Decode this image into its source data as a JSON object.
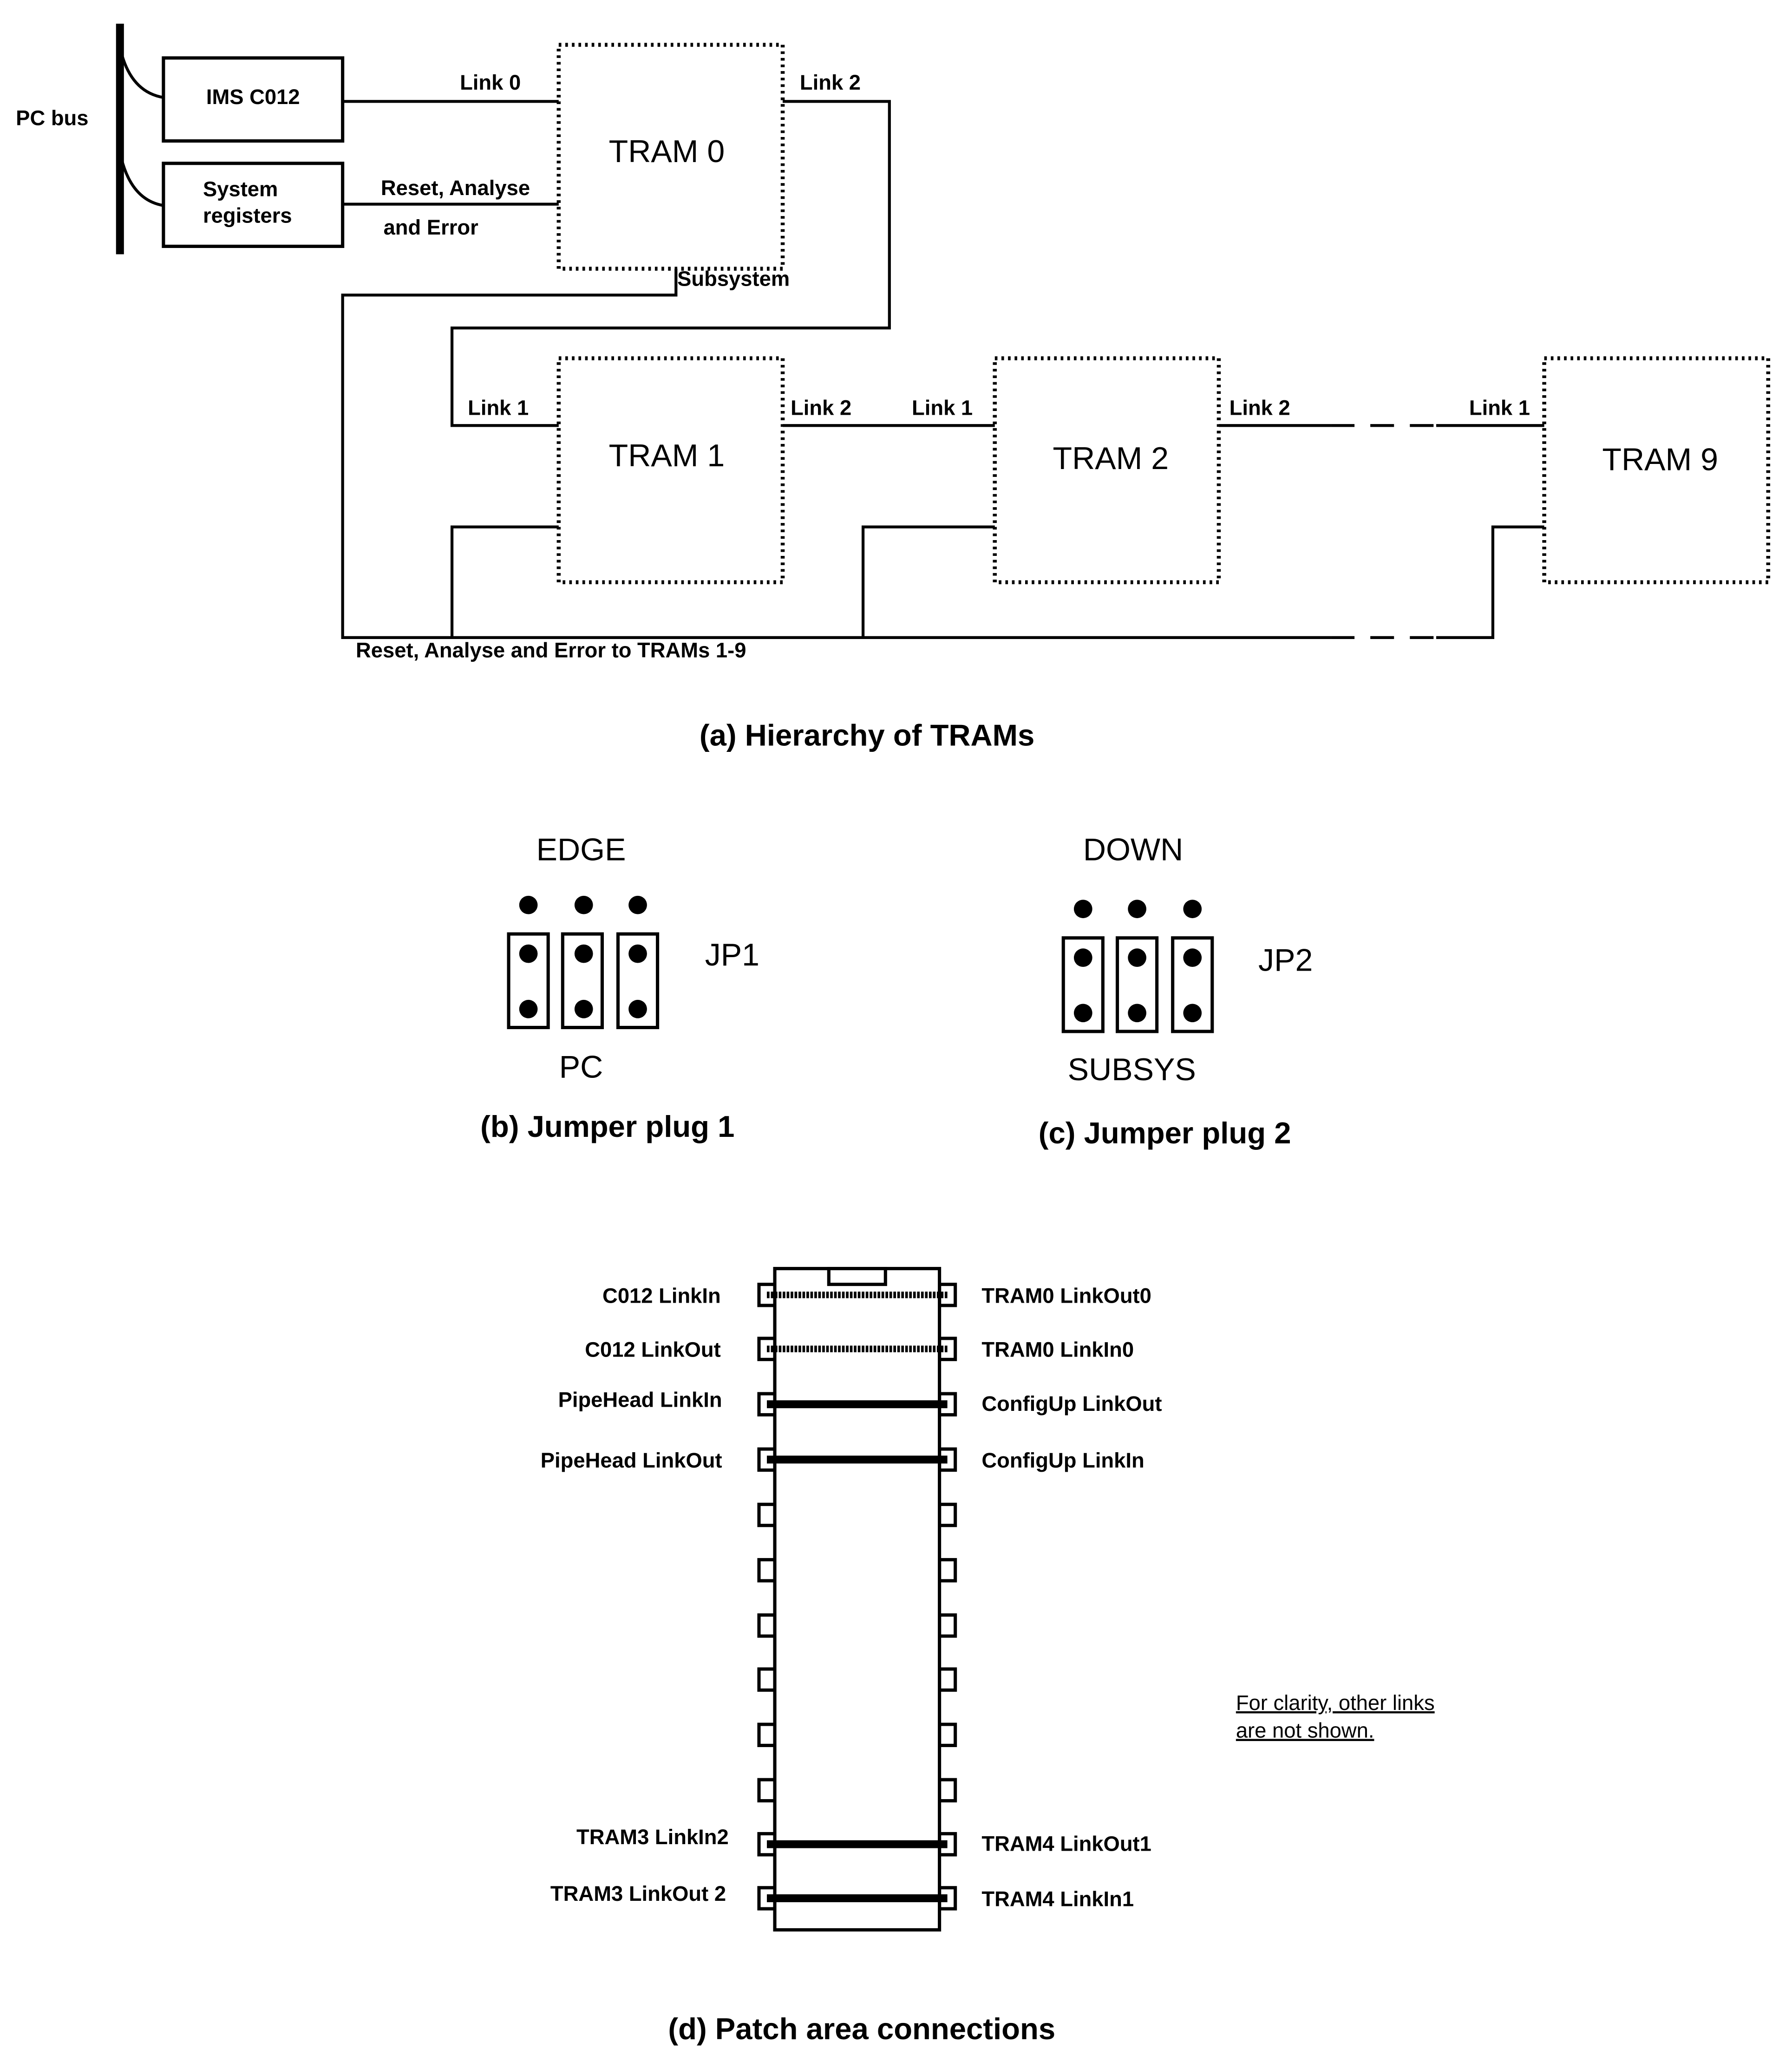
{
  "hierarchy": {
    "pc_bus": "PC bus",
    "ims_c012": "IMS C012",
    "sysreg_line1": "System",
    "sysreg_line2": "registers",
    "link0": "Link 0",
    "reset_line1": "Reset, Analyse",
    "reset_line2": "and Error",
    "tram0": "TRAM 0",
    "tram0_link2": "Link 2",
    "subsystem": "Subsystem",
    "tram1": "TRAM 1",
    "tram1_link1": "Link 1",
    "tram1_link2": "Link 2",
    "tram2": "TRAM 2",
    "tram2_link1": "Link 1",
    "tram2_link2": "Link 2",
    "tram9": "TRAM 9",
    "tram9_link1": "Link 1",
    "reset_bus": "Reset, Analyse and Error to TRAMs 1-9",
    "caption": "(a) Hierarchy of TRAMs"
  },
  "jumper1": {
    "top": "EDGE",
    "bottom": "PC",
    "name": "JP1",
    "caption": "(b) Jumper plug 1"
  },
  "jumper2": {
    "top": "DOWN",
    "bottom": "SUBSYS",
    "name": "JP2",
    "caption": "(c) Jumper plug 2"
  },
  "patch": {
    "left_labels": [
      "C012 LinkIn",
      "C012 LinkOut",
      "PipeHead LinkIn",
      "PipeHead LinkOut",
      "TRAM3 LinkIn2",
      "TRAM3 LinkOut 2"
    ],
    "right_labels": [
      "TRAM0 LinkOut0",
      "TRAM0 LinkIn0",
      "ConfigUp LinkOut",
      "ConfigUp LinkIn",
      "TRAM4 LinkOut1",
      "TRAM4 LinkIn1"
    ],
    "note_line1": "For clarity, other links",
    "note_line2": "are not shown.",
    "caption": "(d) Patch area connections"
  }
}
